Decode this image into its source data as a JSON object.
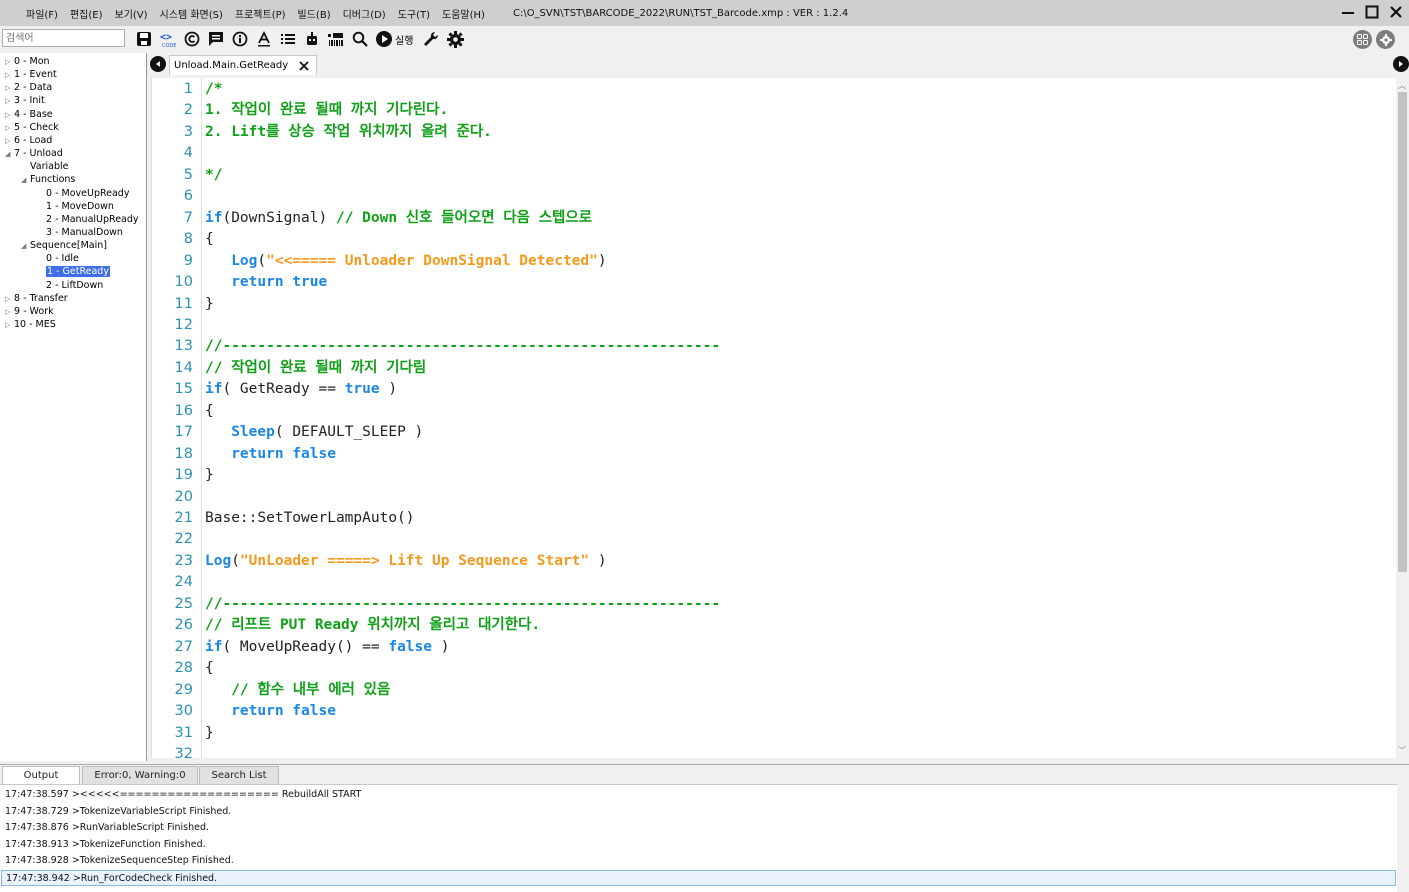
{
  "menu": {
    "items": [
      "파일(F)",
      "편집(E)",
      "보기(V)",
      "시스템 화면(S)",
      "프로젝트(P)",
      "빌드(B)",
      "디버그(D)",
      "도구(T)",
      "도움말(H)"
    ],
    "path": "C:\\O_SVN\\TST\\BARCODE_2022\\RUN\\TST_Barcode.xmp :  VER : 1.2.4"
  },
  "toolbar": {
    "search_placeholder": "검색어",
    "run_label": "실행",
    "icons": [
      "save-icon",
      "code-icon",
      "copyright-icon",
      "comment-icon",
      "info-icon",
      "text-icon",
      "list-icon",
      "robot-icon",
      "barcode-icon",
      "search-icon",
      "play-icon",
      "wrench-icon",
      "gear-icon"
    ]
  },
  "tree": {
    "items": [
      {
        "label": "0 - Mon",
        "level": 0,
        "arrow": "closed"
      },
      {
        "label": "1 - Event",
        "level": 0,
        "arrow": "closed"
      },
      {
        "label": "2 - Data",
        "level": 0,
        "arrow": "closed"
      },
      {
        "label": "3 - Init",
        "level": 0,
        "arrow": "closed"
      },
      {
        "label": "4 - Base",
        "level": 0,
        "arrow": "closed"
      },
      {
        "label": "5 - Check",
        "level": 0,
        "arrow": "closed"
      },
      {
        "label": "6 - Load",
        "level": 0,
        "arrow": "closed"
      },
      {
        "label": "7 - Unload",
        "level": 0,
        "arrow": "open"
      },
      {
        "label": "Variable",
        "level": 1,
        "arrow": "none"
      },
      {
        "label": "Functions",
        "level": 1,
        "arrow": "open"
      },
      {
        "label": "0 - MoveUpReady",
        "level": 2,
        "arrow": "none"
      },
      {
        "label": "1 - MoveDown",
        "level": 2,
        "arrow": "none"
      },
      {
        "label": "2 - ManualUpReady",
        "level": 2,
        "arrow": "none"
      },
      {
        "label": "3 - ManualDown",
        "level": 2,
        "arrow": "none"
      },
      {
        "label": "Sequence[Main]",
        "level": 1,
        "arrow": "open"
      },
      {
        "label": "0 - Idle",
        "level": 2,
        "arrow": "none"
      },
      {
        "label": "1 - GetReady",
        "level": 2,
        "arrow": "none",
        "selected": true
      },
      {
        "label": "2 - LiftDown",
        "level": 2,
        "arrow": "none"
      },
      {
        "label": "8 - Transfer",
        "level": 0,
        "arrow": "closed"
      },
      {
        "label": "9 - Work",
        "level": 0,
        "arrow": "closed"
      },
      {
        "label": "10 - MES",
        "level": 0,
        "arrow": "closed"
      }
    ]
  },
  "editor": {
    "tab_label": "Unload.Main.GetReady",
    "lines": [
      {
        "n": "1",
        "parts": [
          [
            "c",
            "/*"
          ]
        ]
      },
      {
        "n": "2",
        "parts": [
          [
            "c",
            "1. 작업이 완료 될때 까지 기다린다."
          ]
        ]
      },
      {
        "n": "3",
        "parts": [
          [
            "c",
            "2. Lift를 상승 작업 위치까지 올려 준다."
          ]
        ]
      },
      {
        "n": "4",
        "parts": []
      },
      {
        "n": "5",
        "parts": [
          [
            "c",
            "*/"
          ]
        ]
      },
      {
        "n": "6",
        "parts": []
      },
      {
        "n": "7",
        "parts": [
          [
            "k",
            "if"
          ],
          [
            "p",
            "(DownSignal) "
          ],
          [
            "c",
            "// Down 신호 들어오면 다음 스텝으로"
          ]
        ]
      },
      {
        "n": "8",
        "parts": [
          [
            "p",
            "{"
          ]
        ]
      },
      {
        "n": "9",
        "parts": [
          [
            "p",
            "   "
          ],
          [
            "k",
            "Log"
          ],
          [
            "p",
            "("
          ],
          [
            "s",
            "\"<<===== Unloader DownSignal Detected\""
          ],
          [
            "p",
            ")"
          ]
        ]
      },
      {
        "n": "10",
        "parts": [
          [
            "p",
            "   "
          ],
          [
            "k",
            "return true"
          ]
        ]
      },
      {
        "n": "11",
        "parts": [
          [
            "p",
            "}"
          ]
        ]
      },
      {
        "n": "12",
        "parts": []
      },
      {
        "n": "13",
        "parts": [
          [
            "c",
            "//---------------------------------------------------------"
          ]
        ]
      },
      {
        "n": "14",
        "parts": [
          [
            "c",
            "// 작업이 완료 될때 까지 기다림"
          ]
        ]
      },
      {
        "n": "15",
        "parts": [
          [
            "k",
            "if"
          ],
          [
            "p",
            "( GetReady == "
          ],
          [
            "k",
            "true"
          ],
          [
            "p",
            " )"
          ]
        ]
      },
      {
        "n": "16",
        "parts": [
          [
            "p",
            "{"
          ]
        ]
      },
      {
        "n": "17",
        "parts": [
          [
            "p",
            "   "
          ],
          [
            "k",
            "Sleep"
          ],
          [
            "p",
            "( DEFAULT_SLEEP )"
          ]
        ]
      },
      {
        "n": "18",
        "parts": [
          [
            "p",
            "   "
          ],
          [
            "k",
            "return false"
          ]
        ]
      },
      {
        "n": "19",
        "parts": [
          [
            "p",
            "}"
          ]
        ]
      },
      {
        "n": "20",
        "parts": []
      },
      {
        "n": "21",
        "parts": [
          [
            "p",
            "Base::SetTowerLampAuto()"
          ]
        ]
      },
      {
        "n": "22",
        "parts": []
      },
      {
        "n": "23",
        "parts": [
          [
            "k",
            "Log"
          ],
          [
            "p",
            "("
          ],
          [
            "s",
            "\"UnLoader =====> Lift Up Sequence Start\""
          ],
          [
            "p",
            " )"
          ]
        ]
      },
      {
        "n": "24",
        "parts": []
      },
      {
        "n": "25",
        "parts": [
          [
            "c",
            "//---------------------------------------------------------"
          ]
        ]
      },
      {
        "n": "26",
        "parts": [
          [
            "c",
            "// 리프트 PUT Ready 위치까지 올리고 대기한다."
          ]
        ]
      },
      {
        "n": "27",
        "parts": [
          [
            "k",
            "if"
          ],
          [
            "p",
            "( MoveUpReady() == "
          ],
          [
            "k",
            "false"
          ],
          [
            "p",
            " )"
          ]
        ]
      },
      {
        "n": "28",
        "parts": [
          [
            "p",
            "{"
          ]
        ]
      },
      {
        "n": "29",
        "parts": [
          [
            "p",
            "   "
          ],
          [
            "c",
            "// 함수 내부 에러 있음"
          ]
        ]
      },
      {
        "n": "30",
        "parts": [
          [
            "p",
            "   "
          ],
          [
            "k",
            "return false"
          ]
        ]
      },
      {
        "n": "31",
        "parts": [
          [
            "p",
            "}"
          ]
        ]
      },
      {
        "n": "32",
        "parts": []
      }
    ]
  },
  "output": {
    "tabs": [
      "Output",
      "Error:0, Warning:0",
      "Search List"
    ],
    "lines": [
      "17:47:38.597 ><<<<<==================== RebuildAll START",
      "17:47:38.729 >TokenizeVariableScript Finished.",
      "17:47:38.876 >RunVariableScript Finished.",
      "17:47:38.913 >TokenizeFunction Finished.",
      "17:47:38.928 >TokenizeSequenceStep Finished.",
      "17:47:38.942 >Run_ForCodeCheck Finished."
    ]
  },
  "colors": {
    "comment": "#10a018",
    "keyword": "#1a86e6",
    "string": "#f39a1d",
    "line_number": "#2b91af",
    "selection": "#3e6ee8"
  }
}
